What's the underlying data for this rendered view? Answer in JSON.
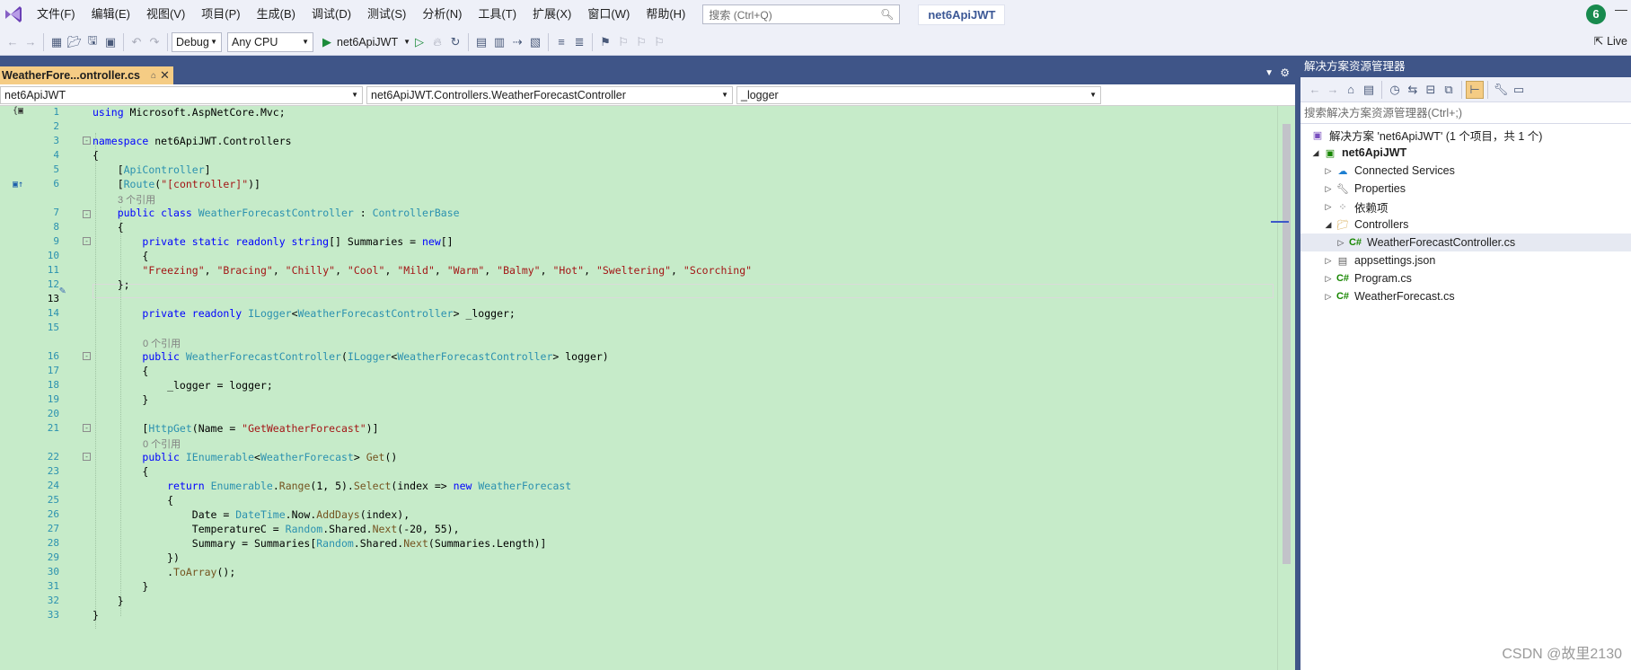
{
  "menubar": {
    "items": [
      "文件(F)",
      "编辑(E)",
      "视图(V)",
      "项目(P)",
      "生成(B)",
      "调试(D)",
      "测试(S)",
      "分析(N)",
      "工具(T)",
      "扩展(X)",
      "窗口(W)",
      "帮助(H)"
    ],
    "search_placeholder": "搜索 (Ctrl+Q)",
    "project_title": "net6ApiJWT",
    "badge": "6"
  },
  "toolbar": {
    "config": "Debug",
    "platform": "Any CPU",
    "run_label": "net6ApiJWT",
    "live_share": "Live"
  },
  "editor": {
    "tab_title": "WeatherFore...ontroller.cs",
    "nav_project": "net6ApiJWT",
    "nav_class": "net6ApiJWT.Controllers.WeatherForecastController",
    "nav_member": "_logger",
    "line_numbers": [
      "1",
      "2",
      "3",
      "4",
      "5",
      "6",
      "7",
      "8",
      "9",
      "10",
      "11",
      "12",
      "13",
      "14",
      "15",
      "16",
      "17",
      "18",
      "19",
      "20",
      "21",
      "22",
      "23",
      "24",
      "25",
      "26",
      "27",
      "28",
      "29",
      "30",
      "31",
      "32",
      "33"
    ],
    "codelens": [
      "3 个引用",
      "0 个引用",
      "0 个引用"
    ]
  },
  "solution_explorer": {
    "title": "解决方案资源管理器",
    "search_placeholder": "搜索解决方案资源管理器(Ctrl+;)",
    "solution": "解决方案 'net6ApiJWT' (1 个项目，共 1 个)",
    "project": "net6ApiJWT",
    "items": [
      "Connected Services",
      "Properties",
      "依赖项",
      "Controllers",
      "WeatherForecastController.cs",
      "appsettings.json",
      "Program.cs",
      "WeatherForecast.cs"
    ]
  },
  "watermark": "CSDN @故里2130"
}
